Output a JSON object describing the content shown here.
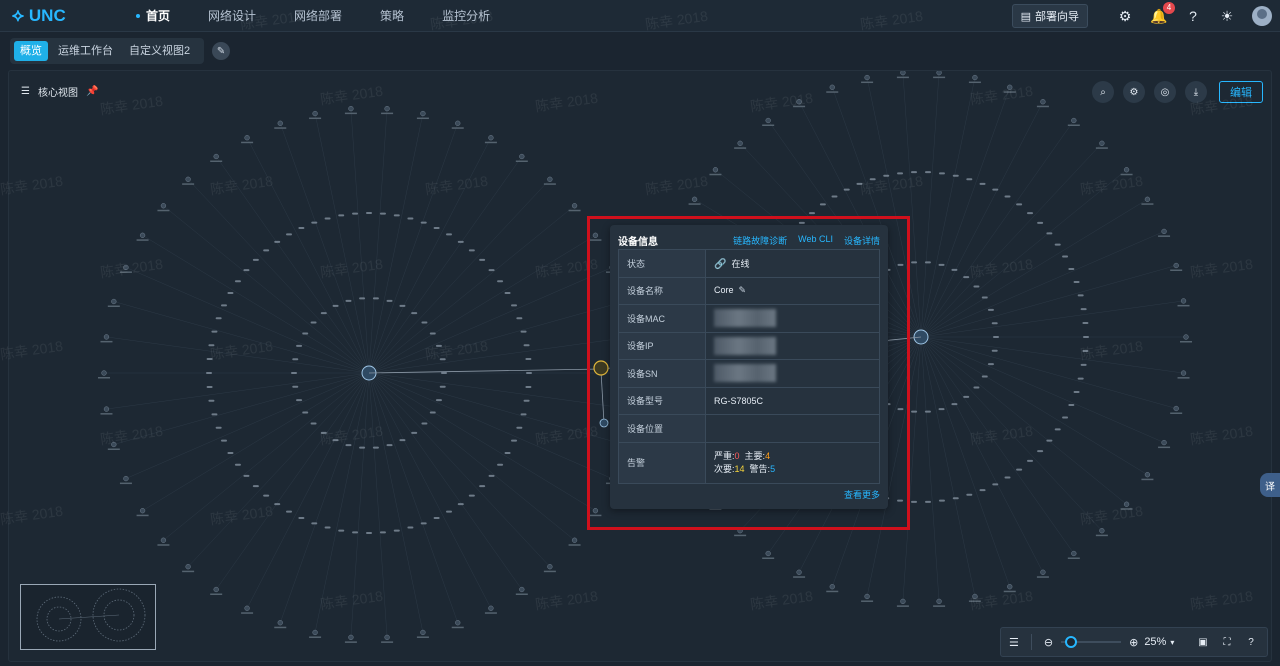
{
  "app": {
    "logo_text": "UNC"
  },
  "nav": {
    "items": [
      "首页",
      "网络设计",
      "网络部署",
      "策略",
      "监控分析"
    ]
  },
  "header": {
    "wizard_label": "部署向导",
    "notification_count": "4"
  },
  "tabs": {
    "items": [
      "概览",
      "运维工作台",
      "自定义视图2"
    ]
  },
  "view": {
    "title": "核心视图",
    "edit_label": "编辑"
  },
  "watermark_text": "陈幸 2018",
  "device_popup": {
    "title": "设备信息",
    "links": [
      "链路故障诊断",
      "Web CLI",
      "设备详情"
    ],
    "rows": {
      "status_label": "状态",
      "status_value": "在线",
      "name_label": "设备名称",
      "name_value": "Core",
      "mac_label": "设备MAC",
      "ip_label": "设备IP",
      "sn_label": "设备SN",
      "model_label": "设备型号",
      "model_value": "RG-S7805C",
      "location_label": "设备位置",
      "location_value": "",
      "alarm_label": "告警"
    },
    "alarms": {
      "critical_label": "严重:",
      "critical_value": "0",
      "major_label": "主要:",
      "major_value": "4",
      "minor_label": "次要:",
      "minor_value": "14",
      "warning_label": "警告:",
      "warning_value": "5"
    },
    "more_label": "查看更多"
  },
  "zoom": {
    "value": "25%",
    "level_fraction": 0.1
  },
  "side_tab_label": "译",
  "colors": {
    "accent": "#27b7ff",
    "highlight_frame": "#d0101c",
    "online": "#2ed573"
  }
}
